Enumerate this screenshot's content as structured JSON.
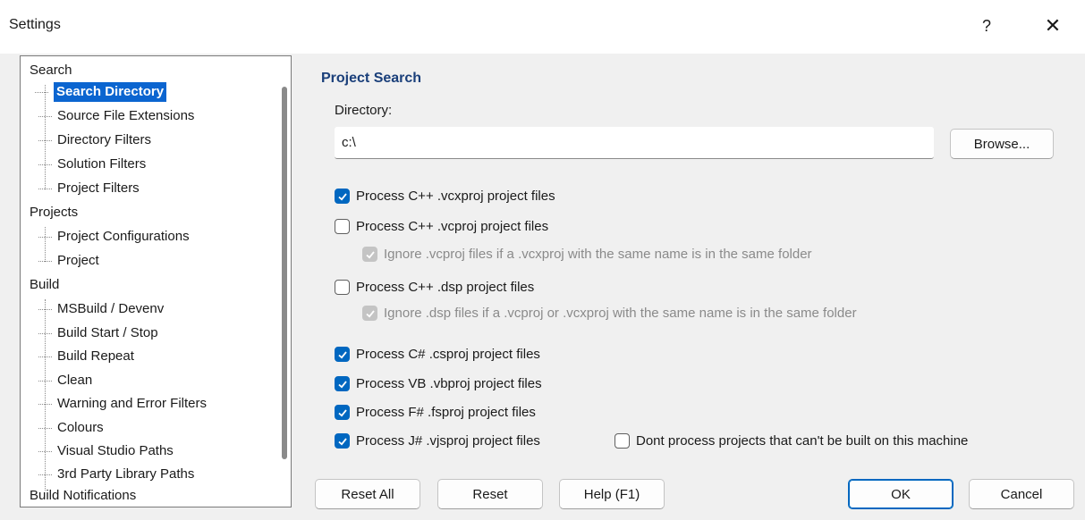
{
  "window": {
    "title": "Settings",
    "help_glyph": "?",
    "close_glyph": "✕"
  },
  "tree": {
    "items": [
      {
        "label": "Search",
        "level": 0
      },
      {
        "label": "Search Directory",
        "level": 1,
        "selected": true
      },
      {
        "label": "Source File Extensions",
        "level": 1
      },
      {
        "label": "Directory Filters",
        "level": 1
      },
      {
        "label": "Solution Filters",
        "level": 1
      },
      {
        "label": "Project Filters",
        "level": 1
      },
      {
        "label": "Projects",
        "level": 0
      },
      {
        "label": "Project Configurations",
        "level": 1
      },
      {
        "label": "Project",
        "level": 1
      },
      {
        "label": "Build",
        "level": 0
      },
      {
        "label": "MSBuild / Devenv",
        "level": 1
      },
      {
        "label": "Build Start / Stop",
        "level": 1
      },
      {
        "label": "Build Repeat",
        "level": 1
      },
      {
        "label": "Clean",
        "level": 1
      },
      {
        "label": "Warning and Error Filters",
        "level": 1
      },
      {
        "label": "Colours",
        "level": 1
      },
      {
        "label": "Visual Studio Paths",
        "level": 1
      },
      {
        "label": "3rd Party Library Paths",
        "level": 1
      },
      {
        "label": "Build Notifications",
        "level": 0
      }
    ]
  },
  "project_search": {
    "title": "Project Search",
    "directory_label": "Directory:",
    "directory_value": "c:\\",
    "browse_label": "Browse...",
    "options": {
      "vcxproj": {
        "label": "Process C++ .vcxproj project files",
        "checked": true
      },
      "vcproj": {
        "label": "Process C++ .vcproj project files",
        "checked": false
      },
      "ignore_vcproj": {
        "label": "Ignore .vcproj files if a .vcxproj with the same name is in the same folder",
        "checked": true,
        "disabled": true
      },
      "dsp": {
        "label": "Process C++ .dsp project files",
        "checked": false
      },
      "ignore_dsp": {
        "label": "Ignore .dsp files if a .vcproj or .vcxproj with the same name is in the same folder",
        "checked": true,
        "disabled": true
      },
      "csproj": {
        "label": "Process C# .csproj project files",
        "checked": true
      },
      "vbproj": {
        "label": "Process VB .vbproj project files",
        "checked": true
      },
      "fsproj": {
        "label": "Process F# .fsproj project files",
        "checked": true
      },
      "vjsproj": {
        "label": "Process J# .vjsproj project files",
        "checked": true
      },
      "dont_process": {
        "label": "Dont process projects that can't be built on this machine",
        "checked": false
      }
    }
  },
  "buttons": {
    "reset_all": "Reset All",
    "reset": "Reset",
    "help": "Help (F1)",
    "ok": "OK",
    "cancel": "Cancel"
  },
  "colors": {
    "accent": "#0067c0",
    "selection": "#0b65d0",
    "section_title": "#1a3f7a"
  }
}
